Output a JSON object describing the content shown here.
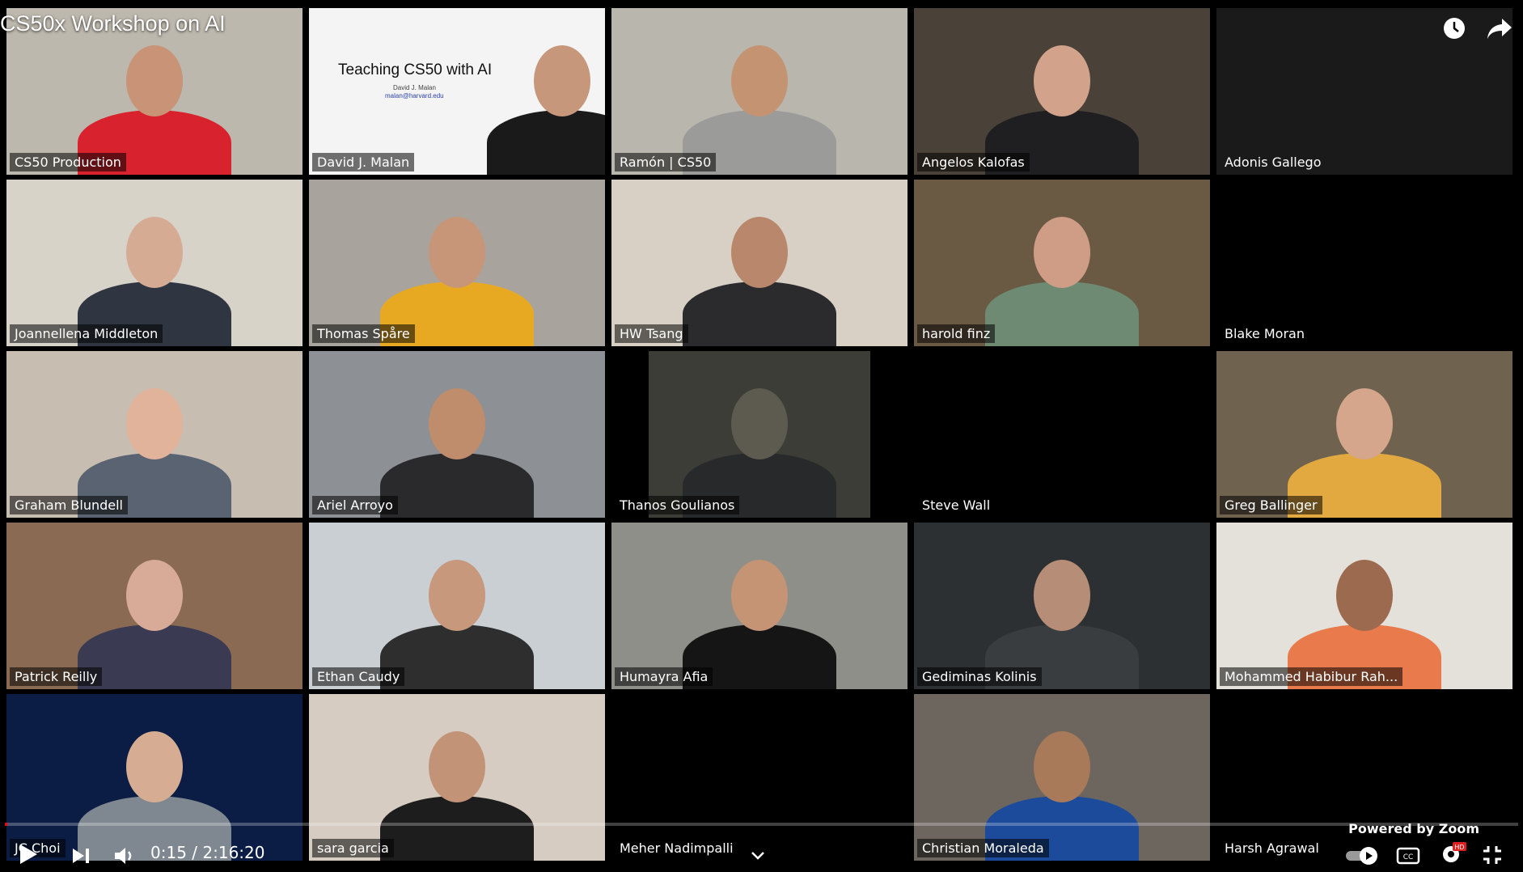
{
  "player": {
    "title": "CS50x Workshop on AI",
    "current_time": "0:15",
    "separator": " / ",
    "duration": "2:16:20",
    "progress_fraction": 0.0018,
    "powered_by": "Powered by Zoom",
    "hd_badge": "HD"
  },
  "slide": {
    "title": "Teaching CS50 with AI",
    "author": "David J. Malan",
    "email": "malan@harvard.edu"
  },
  "tiles": [
    {
      "name": "CS50 Production",
      "bg": "#bdb8ad",
      "shirt": "#d8232e",
      "skin": "#c99377",
      "active": true
    },
    {
      "name": "David J. Malan",
      "bg": "#f4f4f4",
      "shirt": "#1a1a1a",
      "skin": "#c7977c",
      "slide": true
    },
    {
      "name": "Ramón | CS50",
      "bg": "#b9b6ae",
      "shirt": "#9b9b99",
      "skin": "#c49372"
    },
    {
      "name": "Angelos Kalofas",
      "bg": "#4a4238",
      "shirt": "#1f1f22",
      "skin": "#d2a28a"
    },
    {
      "name": "Adonis Gallego",
      "bg": "#1a1a1a",
      "empty": true
    },
    {
      "name": "Joannellena Middleton",
      "bg": "#d8d3c9",
      "shirt": "#303641",
      "skin": "#d6ab94"
    },
    {
      "name": "Thomas Spåre",
      "bg": "#a8a49d",
      "shirt": "#e8a922",
      "skin": "#c79678"
    },
    {
      "name": "HW Tsang",
      "bg": "#d8d0c4",
      "shirt": "#2b2b2d",
      "skin": "#b8876c"
    },
    {
      "name": "harold finz",
      "bg": "#6a5a43",
      "shirt": "#6f8a72",
      "skin": "#cf9d85"
    },
    {
      "name": "Blake Moran",
      "bg": "#000000",
      "empty": true
    },
    {
      "name": "Graham Blundell",
      "bg": "#c7bdb1",
      "shirt": "#5a6371",
      "skin": "#e1b39a"
    },
    {
      "name": "Ariel Arroyo",
      "bg": "#8d9196",
      "shirt": "#2a2a2c",
      "skin": "#bf8c6c"
    },
    {
      "name": "Thanos Goulianos",
      "bg": "#3c3d36",
      "shirt": "#28292a",
      "skin": "#5d5a4f",
      "narrow": true
    },
    {
      "name": "Steve Wall",
      "bg": "#000000",
      "empty": true
    },
    {
      "name": "Greg Ballinger",
      "bg": "#6f6350",
      "shirt": "#e3a941",
      "skin": "#d5a58c"
    },
    {
      "name": "Patrick Reilly",
      "bg": "#8a6a52",
      "shirt": "#3a3a52",
      "skin": "#d7ab97"
    },
    {
      "name": "Ethan Caudy",
      "bg": "#c9cfd3",
      "shirt": "#2e2e2e",
      "skin": "#c7987c"
    },
    {
      "name": "Humayra Afia",
      "bg": "#8f8f89",
      "shirt": "#151515",
      "skin": "#c49474"
    },
    {
      "name": "Gediminas Kolinis",
      "bg": "#2d3033",
      "shirt": "#3a3d40",
      "skin": "#b68d76"
    },
    {
      "name": "Mohammed Habibur Rah...",
      "bg": "#e4e0da",
      "shirt": "#e87a4c",
      "skin": "#9c6a4e"
    },
    {
      "name": "JC Choi",
      "bg": "#0b1d44",
      "shirt": "#7f8890",
      "skin": "#d6ad92"
    },
    {
      "name": "sara garcia",
      "bg": "#d6ccc2",
      "shirt": "#1d1d1d",
      "skin": "#c39378"
    },
    {
      "name": "Meher Nadimpalli",
      "bg": "#000000",
      "empty": true
    },
    {
      "name": "Christian Moraleda",
      "bg": "#6c665f",
      "shirt": "#1c4b9c",
      "skin": "#a87a5a"
    },
    {
      "name": "Harsh Agrawal",
      "bg": "#000000",
      "empty": true
    }
  ],
  "colors": {
    "active_outline": "#6ad03a",
    "progress_played": "#ff0000"
  },
  "icons": {
    "watch_later": "clock-icon",
    "share": "share-arrow-icon",
    "play": "play-icon",
    "next": "next-icon",
    "volume": "volume-icon",
    "autoplay": "autoplay-toggle-icon",
    "captions": "captions-icon",
    "settings": "settings-gear-icon",
    "exit_fullscreen": "exit-fullscreen-icon",
    "chevron": "chevron-down-icon"
  }
}
